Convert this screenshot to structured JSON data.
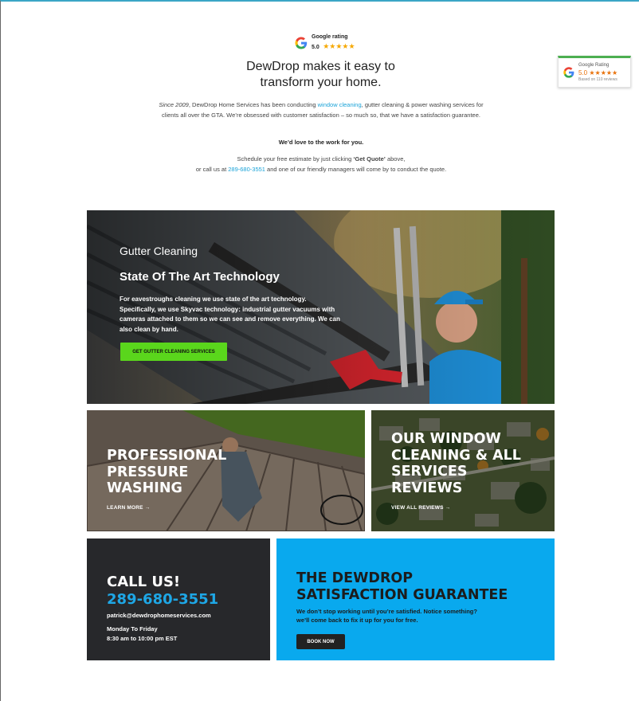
{
  "google_rating": {
    "label": "Google rating",
    "score": "5.0",
    "stars": "★★★★★"
  },
  "headline_line1": "DewDrop makes it easy to",
  "headline_line2": "transform your home.",
  "intro": {
    "since": "Since 2009",
    "p1_a": ", DewDrop Home Services has been conducting ",
    "p1_link": "window cleaning",
    "p1_b": ", gutter cleaning & power washing services for clients all over the GTA. We’re obsessed with customer satisfaction – so much so, that we have a satisfaction guarantee.",
    "p2": "We’d love to the work for you.",
    "p3_a": "Schedule your free estimate by just clicking ",
    "p3_bold": "‘Get Quote’",
    "p3_b": " above,",
    "p3_c": "or call us at ",
    "p3_phone": "289-680-3551",
    "p3_d": " and one of our friendly managers will come by to conduct the quote."
  },
  "badge": {
    "title": "Google Rating",
    "score": "5.0",
    "stars": "★★★★★",
    "sub": "Based on 110 reviews"
  },
  "hero": {
    "eyebrow": "Gutter Cleaning",
    "title": "State Of The Art Technology",
    "body": "For eavestroughs cleaning we use state of the art technology. Specifically, we use Skyvac technology: industrial gutter vacuums with cameras attached to them so we can see and remove everything. We can also clean by hand.",
    "button": "GET GUTTER CLEANING SERVICES"
  },
  "tiles": {
    "pressure": {
      "line1": "PROFESSIONAL",
      "line2": "PRESSURE",
      "line3": "WASHING",
      "link": "LEARN MORE →"
    },
    "window": {
      "line1": "OUR WINDOW",
      "line2": "CLEANING & ALL",
      "line3": "SERVICES",
      "line4": "REVIEWS",
      "link": "VIEW ALL REVIEWS →"
    }
  },
  "call": {
    "title": "CALL US!",
    "phone": "289-680-3551",
    "email": "patrick@dewdrophomeservices.com",
    "hours_label": "Monday To Friday",
    "hours": "8:30 am to 10:00 pm EST"
  },
  "guarantee": {
    "title1": "THE DEWDROP",
    "title2": "SATISFACTION GUARANTEE",
    "body1": "We don’t stop working until you’re satisfied. Notice something?",
    "body2": "we’ll come back to fix it up for you for free.",
    "button": "BOOK NOW"
  },
  "colors": {
    "accent_blue": "#1ea7e6",
    "cta_green": "#5ad61c",
    "guarantee_bg": "#09a9ee",
    "dark_panel": "#27282b"
  }
}
